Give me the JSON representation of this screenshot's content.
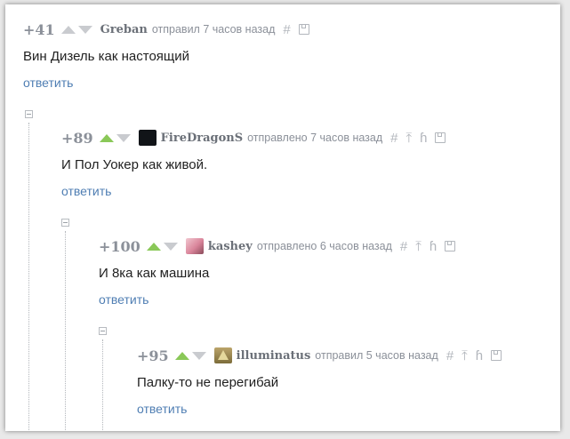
{
  "comments": [
    {
      "rating": "+41",
      "vote_up_active": false,
      "username": "Greban",
      "meta": "отправил 7 часов назад",
      "text": "Вин Дизель как настоящий",
      "reply_label": "ответить",
      "has_avatar": false
    },
    {
      "rating": "+89",
      "vote_up_active": true,
      "username": "FireDragonS",
      "meta": "отправлено 7 часов назад",
      "text": "И Пол Уокер как живой.",
      "reply_label": "ответить",
      "has_avatar": true
    },
    {
      "rating": "+100",
      "vote_up_active": true,
      "username": "kashey",
      "meta": "отправлено 6 часов назад",
      "text": "И 8ка как машина",
      "reply_label": "ответить",
      "has_avatar": true
    },
    {
      "rating": "+95",
      "vote_up_active": true,
      "username": "illuminatus",
      "meta": "отправил 5 часов назад",
      "text": "Палку-то не перегибай",
      "reply_label": "ответить",
      "has_avatar": true
    }
  ],
  "icons": {
    "link": "hash-icon",
    "parent": "arrow-up-icon",
    "thread": "branch-icon",
    "save": "save-icon"
  },
  "colors": {
    "upvote_active": "#8ac858",
    "reply_link": "#4f7eb3",
    "rating": "#8b9099"
  }
}
